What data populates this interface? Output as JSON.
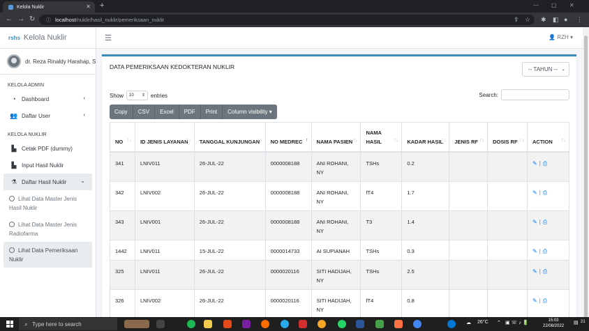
{
  "browser": {
    "tab_title": "Kelola Nuklir",
    "url_host": "localhost",
    "url_path": "/nuklir/hasil_nuklir/pemeriksaan_nuklir"
  },
  "app": {
    "logo": "rshs",
    "brand": "Kelola Nuklir",
    "user_name": "dr. Reza Rinaldy Harahap, S",
    "user_menu": "RZH",
    "accent_color": "#3c8dbc"
  },
  "sidebar": {
    "section_admin": "KELOLA ADMIN",
    "dashboard": "Dashboard",
    "daftar_user": "Daftar User",
    "section_nuklir": "KELOLA NUKLIR",
    "cetak_pdf": "Cetak PDF (dummy)",
    "input_hasil": "Input Hasil Nuklir",
    "daftar_hasil": "Daftar Hasil Nuklir",
    "sub1": "Lihat Data Master Jenis Hasil Nuklir",
    "sub2": "Lihat Data Master Jenis Radiofarma",
    "sub3": "Lihat Data Pemeriksaan Nuklir"
  },
  "main": {
    "title": "DATA PEMERIKSAAN KEDOKTERAN NUKLIR",
    "year_select": "-- TAHUN --",
    "show_label": "Show",
    "entries_value": "10",
    "entries_label": "entries",
    "search_label": "Search:",
    "buttons": {
      "copy": "Copy",
      "csv": "CSV",
      "excel": "Excel",
      "pdf": "PDF",
      "print": "Print",
      "colvis": "Column visibility"
    }
  },
  "table": {
    "headers": {
      "no": "NO",
      "id_jenis": "ID JENIS LAYANAN",
      "tanggal": "TANGGAL KUNJUNGAN",
      "no_medrec": "NO MEDREC",
      "nama_pasien": "NAMA PASIEN",
      "nama_hasil": "NAMA HASIL",
      "kadar_hasil": "KADAR HASIL",
      "jenis_rf": "JENIS RF",
      "dosis_rf": "DOSIS RF",
      "action": "ACTION"
    },
    "rows": [
      {
        "no": "341",
        "id": "LNIV011",
        "tgl": "26-JUL-22",
        "medrec": "0000008188",
        "pasien": "ANI ROHANI, NY",
        "hasil": "TSHs",
        "kadar": "0.2",
        "rf": "",
        "dosis": ""
      },
      {
        "no": "342",
        "id": "LNIV002",
        "tgl": "26-JUL-22",
        "medrec": "0000008188",
        "pasien": "ANI ROHANI, NY",
        "hasil": "fT4",
        "kadar": "1.7",
        "rf": "",
        "dosis": ""
      },
      {
        "no": "343",
        "id": "LNIV001",
        "tgl": "26-JUL-22",
        "medrec": "0000008188",
        "pasien": "ANI ROHANI, NY",
        "hasil": "T3",
        "kadar": "1.4",
        "rf": "",
        "dosis": ""
      },
      {
        "no": "1442",
        "id": "LNIV011",
        "tgl": "15-JUL-22",
        "medrec": "0000014733",
        "pasien": "AI SUPIANAH",
        "hasil": "TSHs",
        "kadar": "0.3",
        "rf": "",
        "dosis": ""
      },
      {
        "no": "325",
        "id": "LNIV011",
        "tgl": "26-JUL-22",
        "medrec": "0000020116",
        "pasien": "SITI HADIJAH, NY",
        "hasil": "TSHs",
        "kadar": "2.5",
        "rf": "",
        "dosis": ""
      },
      {
        "no": "326",
        "id": "LNIV002",
        "tgl": "26-JUL-22",
        "medrec": "0000020116",
        "pasien": "SITI HADIJAH, NY",
        "hasil": "fT4",
        "kadar": "0.8",
        "rf": "",
        "dosis": ""
      }
    ]
  },
  "taskbar": {
    "search_placeholder": "Type here to search",
    "weather": "26°C",
    "time": "15:03",
    "date": "22/08/2022",
    "notif_count": "21"
  }
}
